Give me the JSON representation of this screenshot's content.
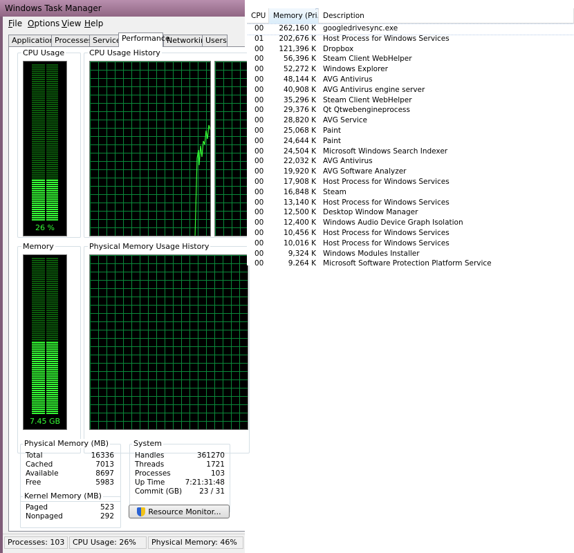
{
  "window": {
    "title": "Windows Task Manager"
  },
  "menu": [
    {
      "underline": "F",
      "rest": "ile"
    },
    {
      "underline": "O",
      "rest": "ptions"
    },
    {
      "underline": "V",
      "rest": "iew"
    },
    {
      "underline": "H",
      "rest": "elp"
    }
  ],
  "tabs": [
    "Applications",
    "Processes",
    "Services",
    "Performance",
    "Networking",
    "Users"
  ],
  "active_tab": "Performance",
  "cpu": {
    "label": "CPU Usage",
    "value_text": "26 %",
    "percent": 26
  },
  "cpu_history": {
    "label": "CPU Usage History"
  },
  "memory": {
    "label": "Memory",
    "value_text": "7.45 GB",
    "percent": 46
  },
  "memory_history": {
    "label": "Physical Memory Usage History"
  },
  "physical_memory": {
    "label": "Physical Memory (MB)",
    "rows": [
      {
        "key": "Total",
        "value": "16336"
      },
      {
        "key": "Cached",
        "value": "7013"
      },
      {
        "key": "Available",
        "value": "8697"
      },
      {
        "key": "Free",
        "value": "5983"
      }
    ]
  },
  "kernel_memory": {
    "label": "Kernel Memory (MB)",
    "rows": [
      {
        "key": "Paged",
        "value": "523"
      },
      {
        "key": "Nonpaged",
        "value": "292"
      }
    ]
  },
  "system": {
    "label": "System",
    "rows": [
      {
        "key": "Handles",
        "value": "361270"
      },
      {
        "key": "Threads",
        "value": "1721"
      },
      {
        "key": "Processes",
        "value": "103"
      },
      {
        "key": "Up Time",
        "value": "7:21:31:48"
      },
      {
        "key": "Commit (GB)",
        "value": "23 / 31"
      }
    ]
  },
  "resource_monitor_button": "Resource Monitor...",
  "statusbar": {
    "processes": "Processes: 103",
    "cpu": "CPU Usage: 26%",
    "memory": "Physical Memory: 46%"
  },
  "process_table": {
    "columns": [
      "CPU",
      "Memory (Pri...",
      "Description"
    ],
    "rows": [
      {
        "cpu": "00",
        "mem": "262,160 K",
        "desc": "googledrivesync.exe"
      },
      {
        "cpu": "01",
        "mem": "202,676 K",
        "desc": "Host Process for Windows Services"
      },
      {
        "cpu": "00",
        "mem": "121,396 K",
        "desc": "Dropbox"
      },
      {
        "cpu": "00",
        "mem": "56,396 K",
        "desc": "Steam Client WebHelper"
      },
      {
        "cpu": "00",
        "mem": "52,272 K",
        "desc": "Windows Explorer"
      },
      {
        "cpu": "00",
        "mem": "48,144 K",
        "desc": "AVG Antivirus"
      },
      {
        "cpu": "00",
        "mem": "40,908 K",
        "desc": "AVG Antivirus engine server"
      },
      {
        "cpu": "00",
        "mem": "35,296 K",
        "desc": "Steam Client WebHelper"
      },
      {
        "cpu": "00",
        "mem": "29,376 K",
        "desc": "Qt Qtwebengineprocess"
      },
      {
        "cpu": "00",
        "mem": "28,820 K",
        "desc": "AVG Service"
      },
      {
        "cpu": "00",
        "mem": "25,068 K",
        "desc": "Paint"
      },
      {
        "cpu": "00",
        "mem": "24,644 K",
        "desc": "Paint"
      },
      {
        "cpu": "00",
        "mem": "24,504 K",
        "desc": "Microsoft Windows Search Indexer"
      },
      {
        "cpu": "00",
        "mem": "22,032 K",
        "desc": "AVG Antivirus"
      },
      {
        "cpu": "00",
        "mem": "19,920 K",
        "desc": "AVG Software Analyzer"
      },
      {
        "cpu": "00",
        "mem": "17,908 K",
        "desc": "Host Process for Windows Services"
      },
      {
        "cpu": "00",
        "mem": "16,848 K",
        "desc": "Steam"
      },
      {
        "cpu": "00",
        "mem": "13,140 K",
        "desc": "Host Process for Windows Services"
      },
      {
        "cpu": "00",
        "mem": "12,500 K",
        "desc": "Desktop Window Manager"
      },
      {
        "cpu": "00",
        "mem": "12,400 K",
        "desc": "Windows Audio Device Graph Isolation"
      },
      {
        "cpu": "00",
        "mem": "10,456 K",
        "desc": "Host Process for Windows Services"
      },
      {
        "cpu": "00",
        "mem": "10,016 K",
        "desc": "Host Process for Windows Services"
      },
      {
        "cpu": "00",
        "mem": "9,324 K",
        "desc": "Windows Modules Installer"
      },
      {
        "cpu": "00",
        "mem": "9,264 K",
        "desc": "Microsoft Software Protection Platform Service"
      }
    ]
  },
  "colors": {
    "meter_green": "#35ff35",
    "grid_green": "#0a8a3a",
    "titlebar": "#906683"
  }
}
